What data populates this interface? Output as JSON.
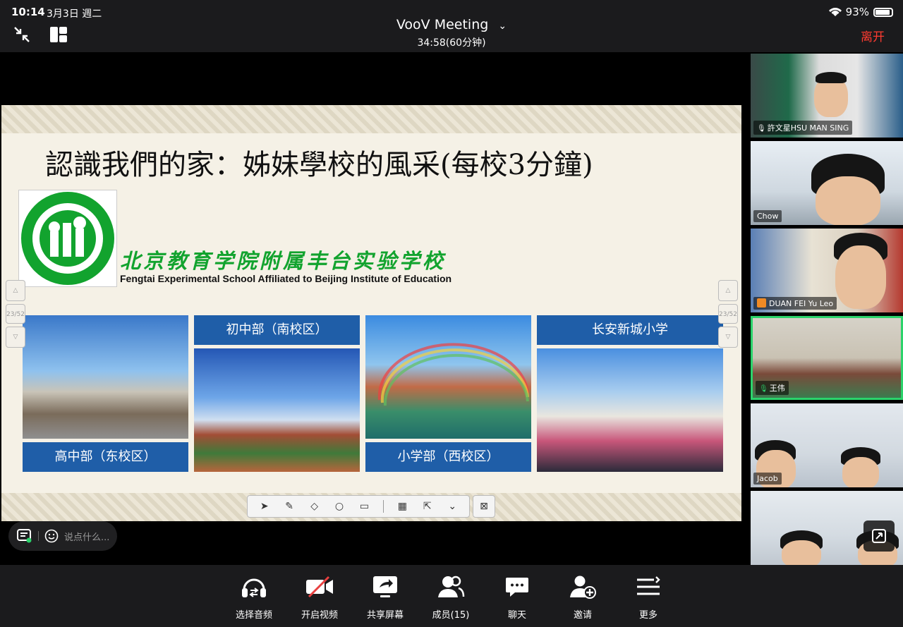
{
  "status_bar": {
    "time": "10:14",
    "date": "3月3日 週二",
    "battery": "93%"
  },
  "header": {
    "title": "VooV Meeting",
    "duration": "34:58(60分钟)",
    "leave_label": "离开"
  },
  "slide": {
    "title": "認識我們的家：姊妹學校的風采(每校3分鐘)",
    "school_cn": "北京教育学院附属丰台实验学校",
    "school_en": "Fengtai Experimental School Affiliated to Beijing Institute of Education",
    "page_indicator": "23/52",
    "captions": {
      "high": "高中部（东校区）",
      "junior": "初中部（南校区）",
      "primary": "小学部（西校区）",
      "changan": "长安新城小学"
    }
  },
  "chat": {
    "placeholder": "说点什么..."
  },
  "participants": [
    {
      "name": "許文星HSU MAN SING",
      "mic": "on"
    },
    {
      "name": "Chow"
    },
    {
      "name": "DUAN FEI Yu Leo",
      "badge": "host"
    },
    {
      "name": "王伟",
      "mic": "active"
    },
    {
      "name": "Jacob"
    },
    {
      "name": ""
    }
  ],
  "toolbar": [
    {
      "label": "选择音频",
      "icon": "headset-icon"
    },
    {
      "label": "开启视频",
      "icon": "video-off-icon"
    },
    {
      "label": "共享屏幕",
      "icon": "share-screen-icon"
    },
    {
      "label": "成员(15)",
      "icon": "members-icon"
    },
    {
      "label": "聊天",
      "icon": "chat-icon"
    },
    {
      "label": "邀请",
      "icon": "invite-icon"
    },
    {
      "label": "更多",
      "icon": "more-icon"
    }
  ],
  "colors": {
    "accent_red": "#ff3b30",
    "active_green": "#2bd36b",
    "caption_blue": "#1f5ea8",
    "school_green": "#12a32e"
  }
}
